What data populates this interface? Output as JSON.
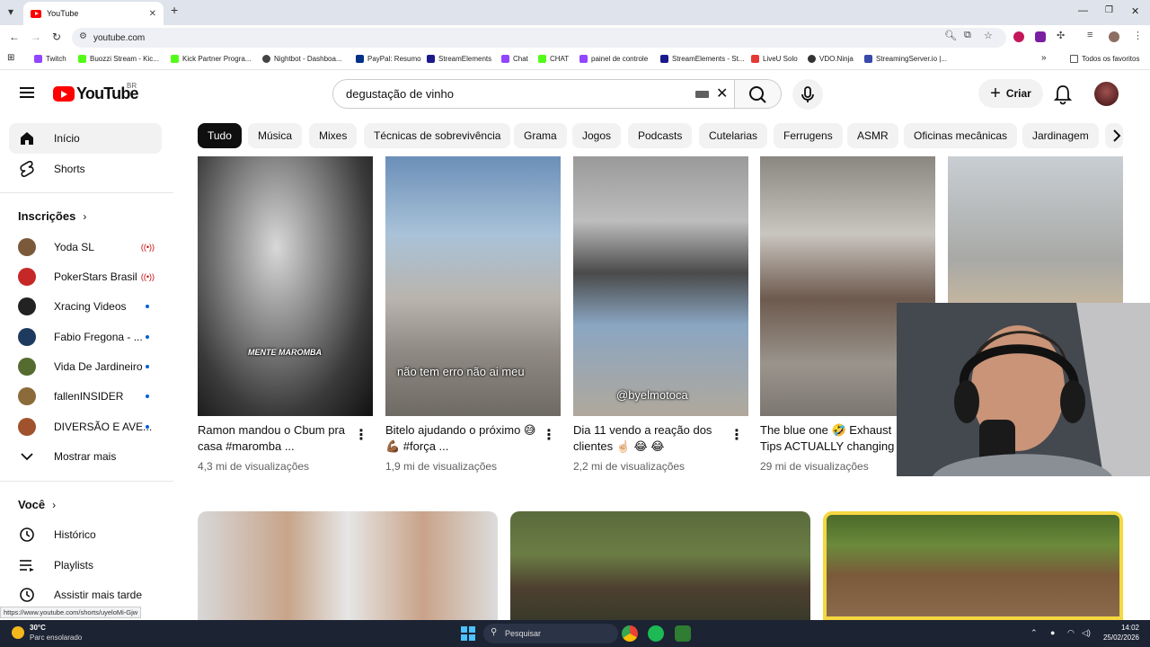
{
  "browser": {
    "tab_title": "YouTube",
    "url": "youtube.com",
    "new_tab": "+",
    "tab_close": "✕",
    "bookmarks": [
      {
        "label": "Twitch",
        "color": "#9146ff"
      },
      {
        "label": "Buozzi Stream - Kic...",
        "color": "#53fc18"
      },
      {
        "label": "Kick Partner Progra...",
        "color": "#53fc18"
      },
      {
        "label": "Nightbot - Dashboa...",
        "color": "#444"
      },
      {
        "label": "PayPal: Resumo",
        "color": "#003087"
      },
      {
        "label": "StreamElements",
        "color": "#1a1a8a"
      },
      {
        "label": "Chat",
        "color": "#9146ff"
      },
      {
        "label": "CHAT",
        "color": "#53fc18"
      },
      {
        "label": "painel de controle",
        "color": "#9146ff"
      },
      {
        "label": "StreamElements - St...",
        "color": "#1a1a8a"
      },
      {
        "label": "LiveU Solo",
        "color": "#e53935"
      },
      {
        "label": "VDO.Ninja",
        "color": "#333"
      },
      {
        "label": "StreamingServer.io |...",
        "color": "#3949ab"
      }
    ],
    "all_bookmarks": "Todos os favoritos",
    "status_url": "https://www.youtube.com/shorts/uyeloMi-Gjw"
  },
  "header": {
    "logo": "YouTube",
    "country": "BR",
    "search_value": "degustação de vinho",
    "create_label": "Criar"
  },
  "sidebar": {
    "home": "Início",
    "shorts": "Shorts",
    "subscriptions_heading": "Inscrições",
    "channels": [
      {
        "name": "Yoda SL",
        "indicator": "live",
        "color": "#7a5a3a"
      },
      {
        "name": "PokerStars Brasil",
        "indicator": "live",
        "color": "#c62828"
      },
      {
        "name": "Xracing Videos",
        "indicator": "dot",
        "color": "#222"
      },
      {
        "name": "Fabio Fregona - ...",
        "indicator": "dot",
        "color": "#1e3a5f"
      },
      {
        "name": "Vida De Jardineiro",
        "indicator": "dot",
        "color": "#556b2f"
      },
      {
        "name": "fallenINSIDER",
        "indicator": "dot",
        "color": "#8b6b3a"
      },
      {
        "name": "DIVERSÃO E AVE...",
        "indicator": "dot",
        "color": "#a0522d"
      }
    ],
    "show_more": "Mostrar mais",
    "you_heading": "Você",
    "history": "Histórico",
    "playlists": "Playlists",
    "watch_later": "Assistir mais tarde"
  },
  "chips": [
    "Tudo",
    "Música",
    "Mixes",
    "Técnicas de sobrevivência",
    "Grama",
    "Jogos",
    "Podcasts",
    "Cutelarias",
    "Ferrugens",
    "ASMR",
    "Oficinas mecânicas",
    "Jardinagem"
  ],
  "shorts": [
    {
      "title": "Ramon mandou o Cbum pra casa #maromba ...",
      "views": "4,3 mi de visualizações",
      "overlay": "MENTE MAROMBA"
    },
    {
      "title": "Bitelo ajudando o próximo 😅 💪🏾 #força ...",
      "views": "1,9 mi de visualizações",
      "overlay": "não tem erro não ai meu"
    },
    {
      "title": "Dia 11 vendo a reação dos clientes ☝🏻 😂 😂",
      "views": "2,2 mi de visualizações",
      "overlay": "@byelmotoca"
    },
    {
      "title": "The blue one 🤣 Exhaust Tips ACTUALLY changing",
      "views": "29 mi de visualizações",
      "overlay": ""
    },
    {
      "title": "",
      "views": "",
      "overlay": ""
    }
  ],
  "taskbar": {
    "temperature": "30°C",
    "weather": "Parc ensolarado",
    "search_placeholder": "Pesquisar",
    "time": "14:02",
    "date": "25/02/2026"
  }
}
